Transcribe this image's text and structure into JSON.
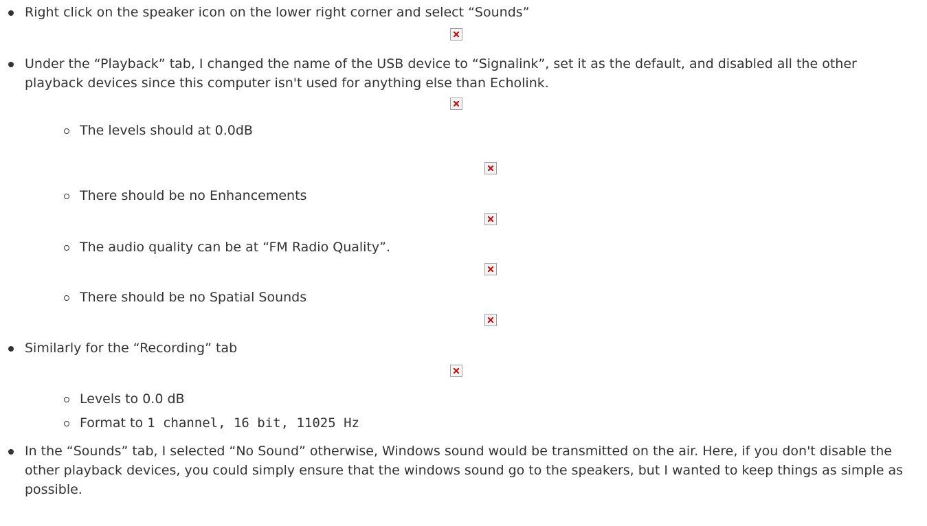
{
  "items": [
    {
      "text": "Right click on the speaker icon on the lower right corner and select “Sounds”"
    },
    {
      "text": "Under the “Playback” tab, I changed the name of the USB device to “Signalink”, set it as the default, and disabled all the other playback devices since this computer isn't used for anything else than Echolink.",
      "subitems": [
        "The levels should at 0.0dB",
        "There should be no Enhancements",
        "The audio quality can be at “FM Radio Quality”.",
        "There should be no Spatial Sounds"
      ]
    },
    {
      "text": "Similarly for the “Recording” tab",
      "subitems": [
        "Levels to 0.0 dB",
        "Format to",
        "1 channel, 16 bit, 11025 Hz"
      ]
    },
    {
      "text": "In the “Sounds” tab, I selected “No Sound” otherwise, Windows sound would be transmitted on the air. Here, if you don't disable the other playback devices, you could simply ensure that the windows sound go to the speakers, but I wanted to keep things as simple as possible."
    }
  ],
  "broken_image_icon": "broken-image-icon",
  "colors": {
    "text": "#333333",
    "broken_x": "#cc0000"
  }
}
